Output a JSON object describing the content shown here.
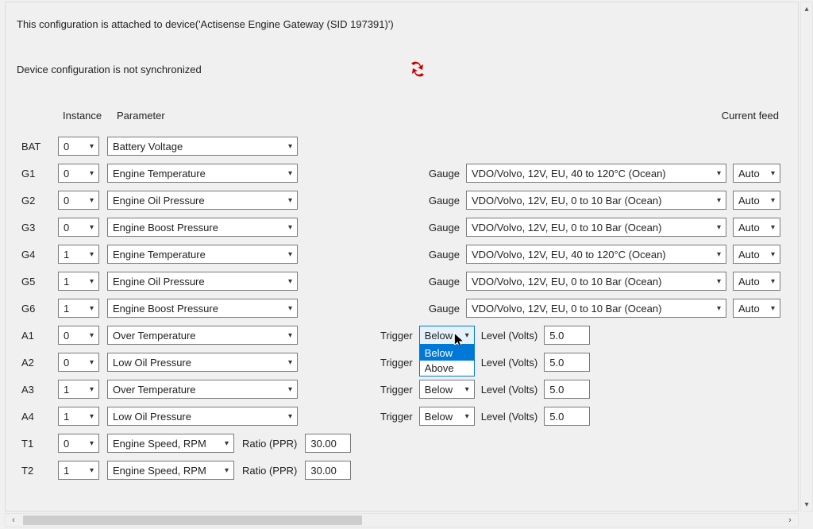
{
  "header": {
    "attached": "This configuration is attached to device('Actisense Engine Gateway (SID 197391)')",
    "syncText": "Device configuration is not synchronized"
  },
  "columns": {
    "instance": "Instance",
    "parameter": "Parameter",
    "currentFeed": "Current feed"
  },
  "labels": {
    "gauge": "Gauge",
    "trigger": "Trigger",
    "levelVolts": "Level (Volts)",
    "ratioPPR": "Ratio (PPR)"
  },
  "triggerOptions": {
    "below": "Below",
    "above": "Above"
  },
  "rows": {
    "BAT": {
      "name": "BAT",
      "instance": "0",
      "parameter": "Battery Voltage"
    },
    "G1": {
      "name": "G1",
      "instance": "0",
      "parameter": "Engine Temperature",
      "gauge": "VDO/Volvo, 12V, EU, 40 to 120°C (Ocean)",
      "feed": "Auto"
    },
    "G2": {
      "name": "G2",
      "instance": "0",
      "parameter": "Engine Oil Pressure",
      "gauge": "VDO/Volvo, 12V, EU, 0 to 10 Bar (Ocean)",
      "feed": "Auto"
    },
    "G3": {
      "name": "G3",
      "instance": "0",
      "parameter": "Engine Boost Pressure",
      "gauge": "VDO/Volvo, 12V, EU, 0 to 10 Bar (Ocean)",
      "feed": "Auto"
    },
    "G4": {
      "name": "G4",
      "instance": "1",
      "parameter": "Engine Temperature",
      "gauge": "VDO/Volvo, 12V, EU, 40 to 120°C (Ocean)",
      "feed": "Auto"
    },
    "G5": {
      "name": "G5",
      "instance": "1",
      "parameter": "Engine Oil Pressure",
      "gauge": "VDO/Volvo, 12V, EU, 0 to 10 Bar (Ocean)",
      "feed": "Auto"
    },
    "G6": {
      "name": "G6",
      "instance": "1",
      "parameter": "Engine Boost Pressure",
      "gauge": "VDO/Volvo, 12V, EU, 0 to 10 Bar (Ocean)",
      "feed": "Auto"
    },
    "A1": {
      "name": "A1",
      "instance": "0",
      "parameter": "Over Temperature",
      "trigger": "Below",
      "level": "5.0"
    },
    "A2": {
      "name": "A2",
      "instance": "0",
      "parameter": "Low Oil Pressure",
      "trigger": "Below",
      "level": "5.0"
    },
    "A3": {
      "name": "A3",
      "instance": "1",
      "parameter": "Over Temperature",
      "trigger": "Below",
      "level": "5.0"
    },
    "A4": {
      "name": "A4",
      "instance": "1",
      "parameter": "Low Oil Pressure",
      "trigger": "Below",
      "level": "5.0"
    },
    "T1": {
      "name": "T1",
      "instance": "0",
      "parameter": "Engine Speed, RPM",
      "ratio": "30.00"
    },
    "T2": {
      "name": "T2",
      "instance": "1",
      "parameter": "Engine Speed, RPM",
      "ratio": "30.00"
    }
  }
}
